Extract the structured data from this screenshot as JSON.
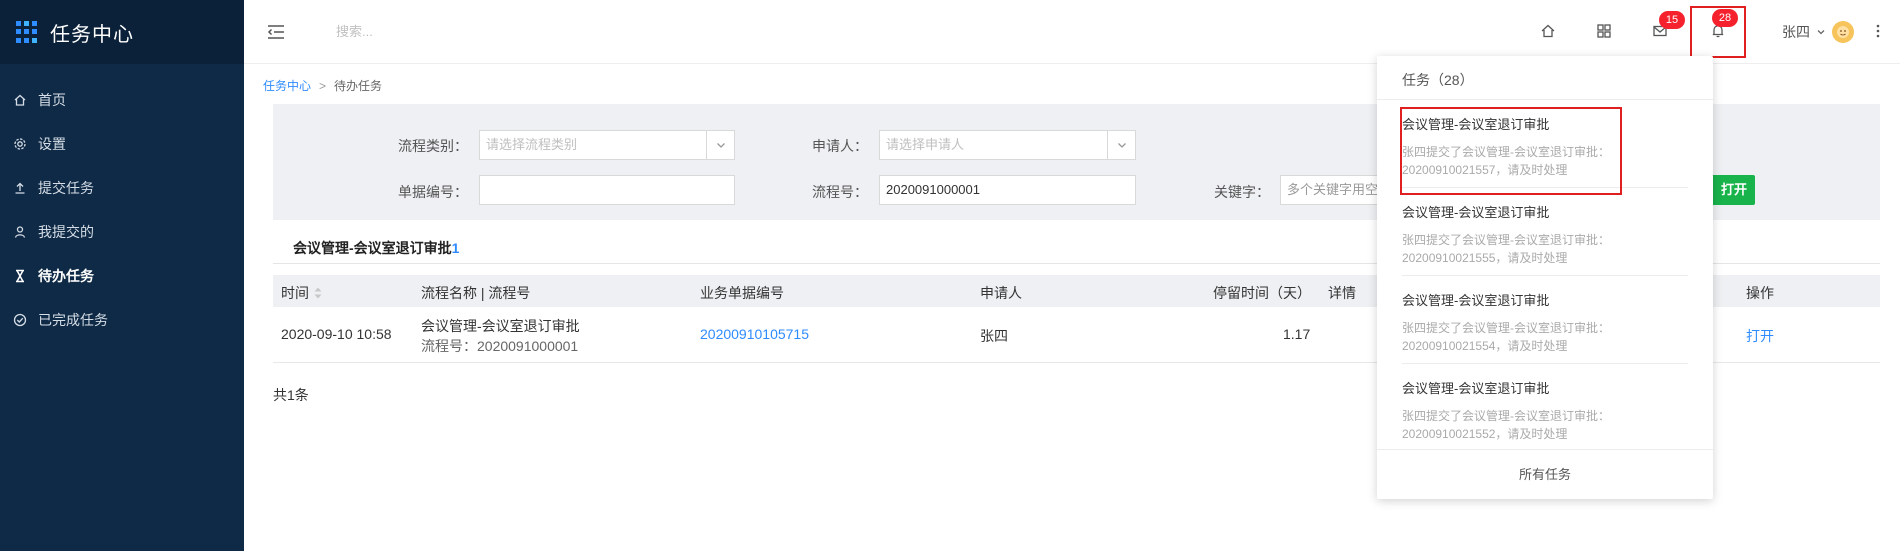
{
  "app": {
    "title": "任务中心"
  },
  "sidebar": {
    "items": [
      {
        "label": "首页",
        "icon": "home-icon"
      },
      {
        "label": "设置",
        "icon": "gear-icon"
      },
      {
        "label": "提交任务",
        "icon": "upload-icon"
      },
      {
        "label": "我提交的",
        "icon": "user-icon"
      },
      {
        "label": "待办任务",
        "icon": "hourglass-icon",
        "active": true
      },
      {
        "label": "已完成任务",
        "icon": "check-circle-icon"
      }
    ]
  },
  "header": {
    "search_placeholder": "搜索...",
    "mail_badge": "15",
    "bell_badge": "28",
    "user_name": "张四"
  },
  "breadcrumb": {
    "root": "任务中心",
    "sep": ">",
    "current": "待办任务"
  },
  "filter": {
    "process_type_label": "流程类别：",
    "process_type_placeholder": "请选择流程类别",
    "applicant_label": "申请人：",
    "applicant_placeholder": "请选择申请人",
    "doc_no_label": "单据编号：",
    "doc_no_value": "",
    "process_no_label": "流程号：",
    "process_no_value": "2020091000001",
    "keyword_label": "关键字：",
    "keyword_placeholder": "多个关键字用空",
    "open_button": "打开"
  },
  "section": {
    "title": "会议管理-会议室退订审批",
    "count": "1"
  },
  "table": {
    "headers": [
      "时间",
      "流程名称 | 流程号",
      "业务单据编号",
      "申请人",
      "停留时间（天）",
      "详情",
      "操作"
    ],
    "rows": [
      {
        "time": "2020-09-10 10:58",
        "process_name": "会议管理-会议室退订审批",
        "process_no": "流程号：2020091000001",
        "doc_no": "2020091010571 5",
        "applicant": "张四",
        "stay_days": "1.17",
        "action": "打开"
      }
    ],
    "total": "共1条"
  },
  "dropdown": {
    "header": "任务（28）",
    "items": [
      {
        "title": "会议管理-会议室退订审批",
        "desc1": "张四提交了会议管理-会议室退订审批：",
        "desc2": "20200910021557，请及时处理"
      },
      {
        "title": "会议管理-会议室退订审批",
        "desc1": "张四提交了会议管理-会议室退订审批：",
        "desc2": "20200910021555，请及时处理"
      },
      {
        "title": "会议管理-会议室退订审批",
        "desc1": "张四提交了会议管理-会议室退订审批：",
        "desc2": "20200910021554，请及时处理"
      },
      {
        "title": "会议管理-会议室退订审批",
        "desc1": "张四提交了会议管理-会议室退订审批：",
        "desc2": "20200910021552，请及时处理"
      }
    ],
    "footer": "所有任务"
  },
  "colors": {
    "sidebar_bg": "#0f2a46",
    "accent": "#2f8cff",
    "badge": "#f5222d",
    "open_button": "#19b34c",
    "highlight": "#e02020"
  }
}
